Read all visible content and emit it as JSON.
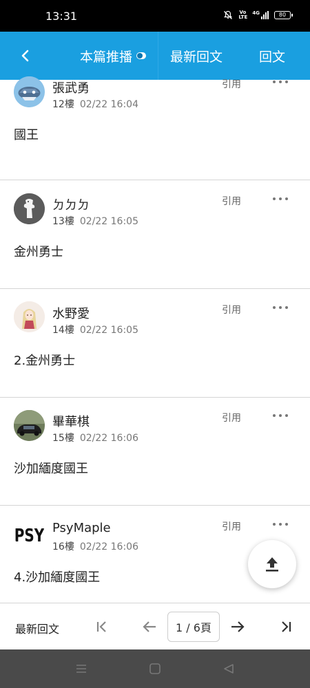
{
  "status_bar": {
    "time": "13:31",
    "volte": "Vo LTE",
    "network": "4G",
    "battery": "80"
  },
  "header": {
    "back_icon": "chevron-left-icon",
    "tabs": [
      {
        "label": "本篇推播"
      },
      {
        "label": "最新回文"
      },
      {
        "label": "回文"
      }
    ]
  },
  "posts": [
    {
      "user": "張武勇",
      "floor": "12樓",
      "time": "02/22 16:04",
      "content": "國王",
      "quote": "引用"
    },
    {
      "user": "ㄉㄉㄉ",
      "floor": "13樓",
      "time": "02/22 16:05",
      "content": "金州勇士",
      "quote": "引用"
    },
    {
      "user": "水野愛",
      "floor": "14樓",
      "time": "02/22 16:05",
      "content": "2.金州勇士",
      "quote": "引用"
    },
    {
      "user": "畢華棋",
      "floor": "15樓",
      "time": "02/22 16:06",
      "content": "沙加緬度國王",
      "quote": "引用"
    },
    {
      "user": "PsyMaple",
      "floor": "16樓",
      "time": "02/22 16:06",
      "content": "4.沙加緬度國王",
      "quote": "引用"
    }
  ],
  "avatar_logo_text": "PSY",
  "pager": {
    "label": "最新回文",
    "page_display": "1 / 6頁"
  },
  "colors": {
    "accent": "#1a9fe0",
    "navbar": "#4a4a4a"
  }
}
